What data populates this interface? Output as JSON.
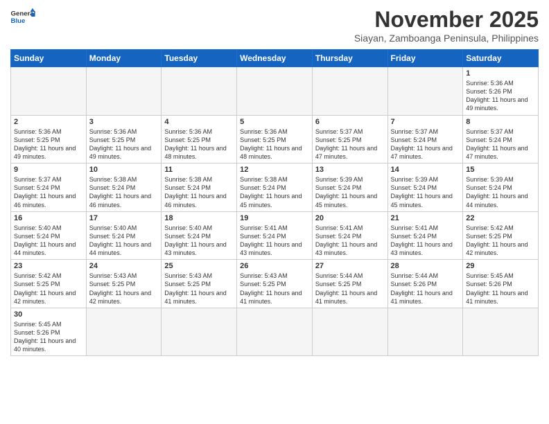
{
  "header": {
    "logo_general": "General",
    "logo_blue": "Blue",
    "month_year": "November 2025",
    "location": "Siayan, Zamboanga Peninsula, Philippines"
  },
  "weekdays": [
    "Sunday",
    "Monday",
    "Tuesday",
    "Wednesday",
    "Thursday",
    "Friday",
    "Saturday"
  ],
  "weeks": [
    [
      {
        "day": "",
        "sunrise": "",
        "sunset": "",
        "daylight": "",
        "empty": true
      },
      {
        "day": "",
        "sunrise": "",
        "sunset": "",
        "daylight": "",
        "empty": true
      },
      {
        "day": "",
        "sunrise": "",
        "sunset": "",
        "daylight": "",
        "empty": true
      },
      {
        "day": "",
        "sunrise": "",
        "sunset": "",
        "daylight": "",
        "empty": true
      },
      {
        "day": "",
        "sunrise": "",
        "sunset": "",
        "daylight": "",
        "empty": true
      },
      {
        "day": "",
        "sunrise": "",
        "sunset": "",
        "daylight": "",
        "empty": true
      },
      {
        "day": "1",
        "sunrise": "Sunrise: 5:36 AM",
        "sunset": "Sunset: 5:26 PM",
        "daylight": "Daylight: 11 hours and 49 minutes.",
        "empty": false
      }
    ],
    [
      {
        "day": "2",
        "sunrise": "Sunrise: 5:36 AM",
        "sunset": "Sunset: 5:25 PM",
        "daylight": "Daylight: 11 hours and 49 minutes.",
        "empty": false
      },
      {
        "day": "3",
        "sunrise": "Sunrise: 5:36 AM",
        "sunset": "Sunset: 5:25 PM",
        "daylight": "Daylight: 11 hours and 49 minutes.",
        "empty": false
      },
      {
        "day": "4",
        "sunrise": "Sunrise: 5:36 AM",
        "sunset": "Sunset: 5:25 PM",
        "daylight": "Daylight: 11 hours and 48 minutes.",
        "empty": false
      },
      {
        "day": "5",
        "sunrise": "Sunrise: 5:36 AM",
        "sunset": "Sunset: 5:25 PM",
        "daylight": "Daylight: 11 hours and 48 minutes.",
        "empty": false
      },
      {
        "day": "6",
        "sunrise": "Sunrise: 5:37 AM",
        "sunset": "Sunset: 5:25 PM",
        "daylight": "Daylight: 11 hours and 47 minutes.",
        "empty": false
      },
      {
        "day": "7",
        "sunrise": "Sunrise: 5:37 AM",
        "sunset": "Sunset: 5:24 PM",
        "daylight": "Daylight: 11 hours and 47 minutes.",
        "empty": false
      },
      {
        "day": "8",
        "sunrise": "Sunrise: 5:37 AM",
        "sunset": "Sunset: 5:24 PM",
        "daylight": "Daylight: 11 hours and 47 minutes.",
        "empty": false
      }
    ],
    [
      {
        "day": "9",
        "sunrise": "Sunrise: 5:37 AM",
        "sunset": "Sunset: 5:24 PM",
        "daylight": "Daylight: 11 hours and 46 minutes.",
        "empty": false
      },
      {
        "day": "10",
        "sunrise": "Sunrise: 5:38 AM",
        "sunset": "Sunset: 5:24 PM",
        "daylight": "Daylight: 11 hours and 46 minutes.",
        "empty": false
      },
      {
        "day": "11",
        "sunrise": "Sunrise: 5:38 AM",
        "sunset": "Sunset: 5:24 PM",
        "daylight": "Daylight: 11 hours and 46 minutes.",
        "empty": false
      },
      {
        "day": "12",
        "sunrise": "Sunrise: 5:38 AM",
        "sunset": "Sunset: 5:24 PM",
        "daylight": "Daylight: 11 hours and 45 minutes.",
        "empty": false
      },
      {
        "day": "13",
        "sunrise": "Sunrise: 5:39 AM",
        "sunset": "Sunset: 5:24 PM",
        "daylight": "Daylight: 11 hours and 45 minutes.",
        "empty": false
      },
      {
        "day": "14",
        "sunrise": "Sunrise: 5:39 AM",
        "sunset": "Sunset: 5:24 PM",
        "daylight": "Daylight: 11 hours and 45 minutes.",
        "empty": false
      },
      {
        "day": "15",
        "sunrise": "Sunrise: 5:39 AM",
        "sunset": "Sunset: 5:24 PM",
        "daylight": "Daylight: 11 hours and 44 minutes.",
        "empty": false
      }
    ],
    [
      {
        "day": "16",
        "sunrise": "Sunrise: 5:40 AM",
        "sunset": "Sunset: 5:24 PM",
        "daylight": "Daylight: 11 hours and 44 minutes.",
        "empty": false
      },
      {
        "day": "17",
        "sunrise": "Sunrise: 5:40 AM",
        "sunset": "Sunset: 5:24 PM",
        "daylight": "Daylight: 11 hours and 44 minutes.",
        "empty": false
      },
      {
        "day": "18",
        "sunrise": "Sunrise: 5:40 AM",
        "sunset": "Sunset: 5:24 PM",
        "daylight": "Daylight: 11 hours and 43 minutes.",
        "empty": false
      },
      {
        "day": "19",
        "sunrise": "Sunrise: 5:41 AM",
        "sunset": "Sunset: 5:24 PM",
        "daylight": "Daylight: 11 hours and 43 minutes.",
        "empty": false
      },
      {
        "day": "20",
        "sunrise": "Sunrise: 5:41 AM",
        "sunset": "Sunset: 5:24 PM",
        "daylight": "Daylight: 11 hours and 43 minutes.",
        "empty": false
      },
      {
        "day": "21",
        "sunrise": "Sunrise: 5:41 AM",
        "sunset": "Sunset: 5:24 PM",
        "daylight": "Daylight: 11 hours and 43 minutes.",
        "empty": false
      },
      {
        "day": "22",
        "sunrise": "Sunrise: 5:42 AM",
        "sunset": "Sunset: 5:25 PM",
        "daylight": "Daylight: 11 hours and 42 minutes.",
        "empty": false
      }
    ],
    [
      {
        "day": "23",
        "sunrise": "Sunrise: 5:42 AM",
        "sunset": "Sunset: 5:25 PM",
        "daylight": "Daylight: 11 hours and 42 minutes.",
        "empty": false
      },
      {
        "day": "24",
        "sunrise": "Sunrise: 5:43 AM",
        "sunset": "Sunset: 5:25 PM",
        "daylight": "Daylight: 11 hours and 42 minutes.",
        "empty": false
      },
      {
        "day": "25",
        "sunrise": "Sunrise: 5:43 AM",
        "sunset": "Sunset: 5:25 PM",
        "daylight": "Daylight: 11 hours and 41 minutes.",
        "empty": false
      },
      {
        "day": "26",
        "sunrise": "Sunrise: 5:43 AM",
        "sunset": "Sunset: 5:25 PM",
        "daylight": "Daylight: 11 hours and 41 minutes.",
        "empty": false
      },
      {
        "day": "27",
        "sunrise": "Sunrise: 5:44 AM",
        "sunset": "Sunset: 5:25 PM",
        "daylight": "Daylight: 11 hours and 41 minutes.",
        "empty": false
      },
      {
        "day": "28",
        "sunrise": "Sunrise: 5:44 AM",
        "sunset": "Sunset: 5:26 PM",
        "daylight": "Daylight: 11 hours and 41 minutes.",
        "empty": false
      },
      {
        "day": "29",
        "sunrise": "Sunrise: 5:45 AM",
        "sunset": "Sunset: 5:26 PM",
        "daylight": "Daylight: 11 hours and 41 minutes.",
        "empty": false
      }
    ],
    [
      {
        "day": "30",
        "sunrise": "Sunrise: 5:45 AM",
        "sunset": "Sunset: 5:26 PM",
        "daylight": "Daylight: 11 hours and 40 minutes.",
        "empty": false
      },
      {
        "day": "",
        "sunrise": "",
        "sunset": "",
        "daylight": "",
        "empty": true
      },
      {
        "day": "",
        "sunrise": "",
        "sunset": "",
        "daylight": "",
        "empty": true
      },
      {
        "day": "",
        "sunrise": "",
        "sunset": "",
        "daylight": "",
        "empty": true
      },
      {
        "day": "",
        "sunrise": "",
        "sunset": "",
        "daylight": "",
        "empty": true
      },
      {
        "day": "",
        "sunrise": "",
        "sunset": "",
        "daylight": "",
        "empty": true
      },
      {
        "day": "",
        "sunrise": "",
        "sunset": "",
        "daylight": "",
        "empty": true
      }
    ]
  ]
}
